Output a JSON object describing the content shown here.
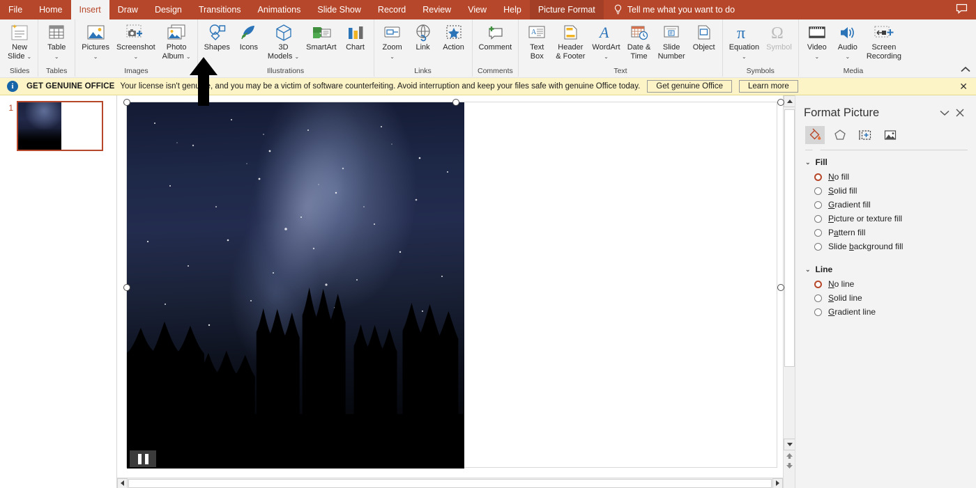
{
  "window": {
    "comment_icon": "comment-icon"
  },
  "tabs": [
    {
      "label": "File",
      "state": "normal"
    },
    {
      "label": "Home",
      "state": "normal"
    },
    {
      "label": "Insert",
      "state": "active"
    },
    {
      "label": "Draw",
      "state": "normal"
    },
    {
      "label": "Design",
      "state": "normal"
    },
    {
      "label": "Transitions",
      "state": "normal"
    },
    {
      "label": "Animations",
      "state": "normal"
    },
    {
      "label": "Slide Show",
      "state": "normal"
    },
    {
      "label": "Record",
      "state": "normal"
    },
    {
      "label": "Review",
      "state": "normal"
    },
    {
      "label": "View",
      "state": "normal"
    },
    {
      "label": "Help",
      "state": "normal"
    },
    {
      "label": "Picture Format",
      "state": "contextual"
    }
  ],
  "tellme": {
    "icon": "lightbulb-icon",
    "text": "Tell me what you want to do"
  },
  "ribbon": {
    "groups": [
      {
        "name": "Slides",
        "label": "Slides",
        "buttons": [
          {
            "name": "new-slide",
            "line1": "New",
            "line2": "Slide",
            "caret": true,
            "icon": "new-slide-icon"
          }
        ]
      },
      {
        "name": "Tables",
        "label": "Tables",
        "buttons": [
          {
            "name": "table",
            "line1": "Table",
            "line2": "",
            "caret": true,
            "icon": "table-icon"
          }
        ]
      },
      {
        "name": "Images",
        "label": "Images",
        "buttons": [
          {
            "name": "pictures",
            "line1": "Pictures",
            "line2": "",
            "caret": true,
            "icon": "pictures-icon"
          },
          {
            "name": "screenshot",
            "line1": "Screenshot",
            "line2": "",
            "caret": true,
            "icon": "screenshot-icon"
          },
          {
            "name": "photo-album",
            "line1": "Photo",
            "line2": "Album",
            "caret": true,
            "icon": "photo-album-icon"
          }
        ]
      },
      {
        "name": "Illustrations",
        "label": "Illustrations",
        "buttons": [
          {
            "name": "shapes",
            "line1": "Shapes",
            "line2": "",
            "caret": false,
            "icon": "shapes-icon"
          },
          {
            "name": "icons",
            "line1": "Icons",
            "line2": "",
            "caret": false,
            "icon": "icons-icon"
          },
          {
            "name": "3d-models",
            "line1": "3D",
            "line2": "Models",
            "caret": true,
            "icon": "3d-models-icon"
          },
          {
            "name": "smartart",
            "line1": "SmartArt",
            "line2": "",
            "caret": false,
            "icon": "smartart-icon"
          },
          {
            "name": "chart",
            "line1": "Chart",
            "line2": "",
            "caret": false,
            "icon": "chart-icon"
          }
        ]
      },
      {
        "name": "Links",
        "label": "Links",
        "buttons": [
          {
            "name": "zoom",
            "line1": "Zoom",
            "line2": "",
            "caret": true,
            "icon": "zoom-icon"
          },
          {
            "name": "link",
            "line1": "Link",
            "line2": "",
            "caret": false,
            "icon": "link-icon"
          },
          {
            "name": "action",
            "line1": "Action",
            "line2": "",
            "caret": false,
            "icon": "action-icon"
          }
        ]
      },
      {
        "name": "Comments",
        "label": "Comments",
        "buttons": [
          {
            "name": "comment",
            "line1": "Comment",
            "line2": "",
            "caret": false,
            "icon": "comment-plus-icon"
          }
        ]
      },
      {
        "name": "Text",
        "label": "Text",
        "buttons": [
          {
            "name": "text-box",
            "line1": "Text",
            "line2": "Box",
            "caret": false,
            "icon": "text-box-icon"
          },
          {
            "name": "header-footer",
            "line1": "Header",
            "line2": "& Footer",
            "caret": false,
            "icon": "header-footer-icon"
          },
          {
            "name": "wordart",
            "line1": "WordArt",
            "line2": "",
            "caret": true,
            "icon": "wordart-icon"
          },
          {
            "name": "date-time",
            "line1": "Date &",
            "line2": "Time",
            "caret": false,
            "icon": "date-time-icon"
          },
          {
            "name": "slide-number",
            "line1": "Slide",
            "line2": "Number",
            "caret": false,
            "icon": "slide-number-icon"
          },
          {
            "name": "object",
            "line1": "Object",
            "line2": "",
            "caret": false,
            "icon": "object-icon"
          }
        ]
      },
      {
        "name": "Symbols",
        "label": "Symbols",
        "buttons": [
          {
            "name": "equation",
            "line1": "Equation",
            "line2": "",
            "caret": true,
            "icon": "equation-icon"
          },
          {
            "name": "symbol",
            "line1": "Symbol",
            "line2": "",
            "caret": false,
            "icon": "symbol-icon",
            "disabled": true
          }
        ]
      },
      {
        "name": "Media",
        "label": "Media",
        "buttons": [
          {
            "name": "video",
            "line1": "Video",
            "line2": "",
            "caret": true,
            "icon": "video-icon"
          },
          {
            "name": "audio",
            "line1": "Audio",
            "line2": "",
            "caret": true,
            "icon": "audio-icon"
          },
          {
            "name": "screen-recording",
            "line1": "Screen",
            "line2": "Recording",
            "caret": false,
            "icon": "screen-recording-icon"
          }
        ]
      }
    ],
    "collapse_icon": "chevron-up-icon"
  },
  "notice": {
    "icon": "info-icon",
    "title": "GET GENUINE OFFICE",
    "text": "Your license isn't genuine, and you may be a victim of software counterfeiting. Avoid interruption and keep your files safe with genuine Office today.",
    "primary_button": "Get genuine Office",
    "secondary_button": "Learn more",
    "close_icon": "close-icon"
  },
  "thumbnails": [
    {
      "number": "1",
      "selected": true
    }
  ],
  "slide": {
    "picture_alt": "night-sky-forest-photo",
    "overlay_badge": "pause-bars"
  },
  "pane": {
    "title": "Format Picture",
    "collapse_icon": "chevron-down-icon",
    "close_icon": "close-icon",
    "tabs": [
      {
        "name": "fill-line-tab",
        "icon": "paint-bucket-icon",
        "active": true
      },
      {
        "name": "effects-tab",
        "icon": "pentagon-icon",
        "active": false
      },
      {
        "name": "size-properties-tab",
        "icon": "size-layout-icon",
        "active": false
      },
      {
        "name": "picture-tab",
        "icon": "picture-icon",
        "active": false
      }
    ],
    "sections": [
      {
        "name": "fill",
        "title": "Fill",
        "expanded": true,
        "options": [
          {
            "label": "No fill",
            "accesskey": "N",
            "checked": true
          },
          {
            "label": "Solid fill",
            "accesskey": "S",
            "checked": false
          },
          {
            "label": "Gradient fill",
            "accesskey": "G",
            "checked": false
          },
          {
            "label": "Picture or texture fill",
            "accesskey": "P",
            "checked": false
          },
          {
            "label": "Pattern fill",
            "accesskey": "a",
            "checked": false
          },
          {
            "label": "Slide background fill",
            "accesskey": "b",
            "checked": false
          }
        ]
      },
      {
        "name": "line",
        "title": "Line",
        "expanded": true,
        "options": [
          {
            "label": "No line",
            "accesskey": "N",
            "checked": true
          },
          {
            "label": "Solid line",
            "accesskey": "S",
            "checked": false
          },
          {
            "label": "Gradient line",
            "accesskey": "G",
            "checked": false
          }
        ]
      }
    ]
  },
  "colors": {
    "brand": "#b7472a",
    "ribbon_bg": "#f3f3f3",
    "notice_bg": "#fcf3c6",
    "accent_red": "#b7472a"
  }
}
